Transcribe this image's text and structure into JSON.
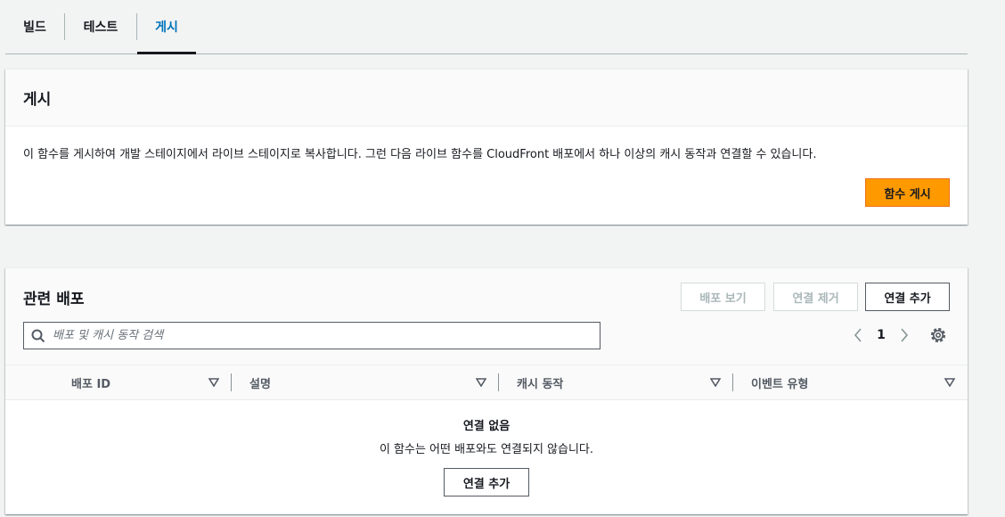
{
  "tabs": [
    {
      "label": "빌드"
    },
    {
      "label": "테스트"
    },
    {
      "label": "게시"
    }
  ],
  "publish": {
    "title": "게시",
    "description": "이 함수를 게시하여 개발 스테이지에서 라이브 스테이지로 복사합니다. 그런 다음 라이브 함수를 CloudFront 배포에서 하나 이상의 캐시 동작과 연결할 수 있습니다.",
    "button_label": "함수 게시"
  },
  "distributions": {
    "title": "관련 배포",
    "buttons": {
      "view": "배포 보기",
      "remove": "연결 제거",
      "add": "연결 추가"
    },
    "search_placeholder": "배포 및 캐시 동작 검색",
    "pagination": {
      "current_page": "1"
    },
    "columns": [
      {
        "label": "배포 ID"
      },
      {
        "label": "설명"
      },
      {
        "label": "캐시 동작"
      },
      {
        "label": "이벤트 유형"
      }
    ],
    "empty": {
      "title": "연결 없음",
      "description": "이 함수는 어떤 배포와도 연결되지 않습니다.",
      "button_label": "연결 추가"
    }
  },
  "colors": {
    "accent": "#0073bb",
    "primary_button": "#ff9900",
    "text": "#16191f",
    "muted": "#545b64"
  },
  "icons": [
    "search-icon",
    "chevron-left-icon",
    "chevron-right-icon",
    "gear-icon",
    "sort-caret-icon"
  ]
}
